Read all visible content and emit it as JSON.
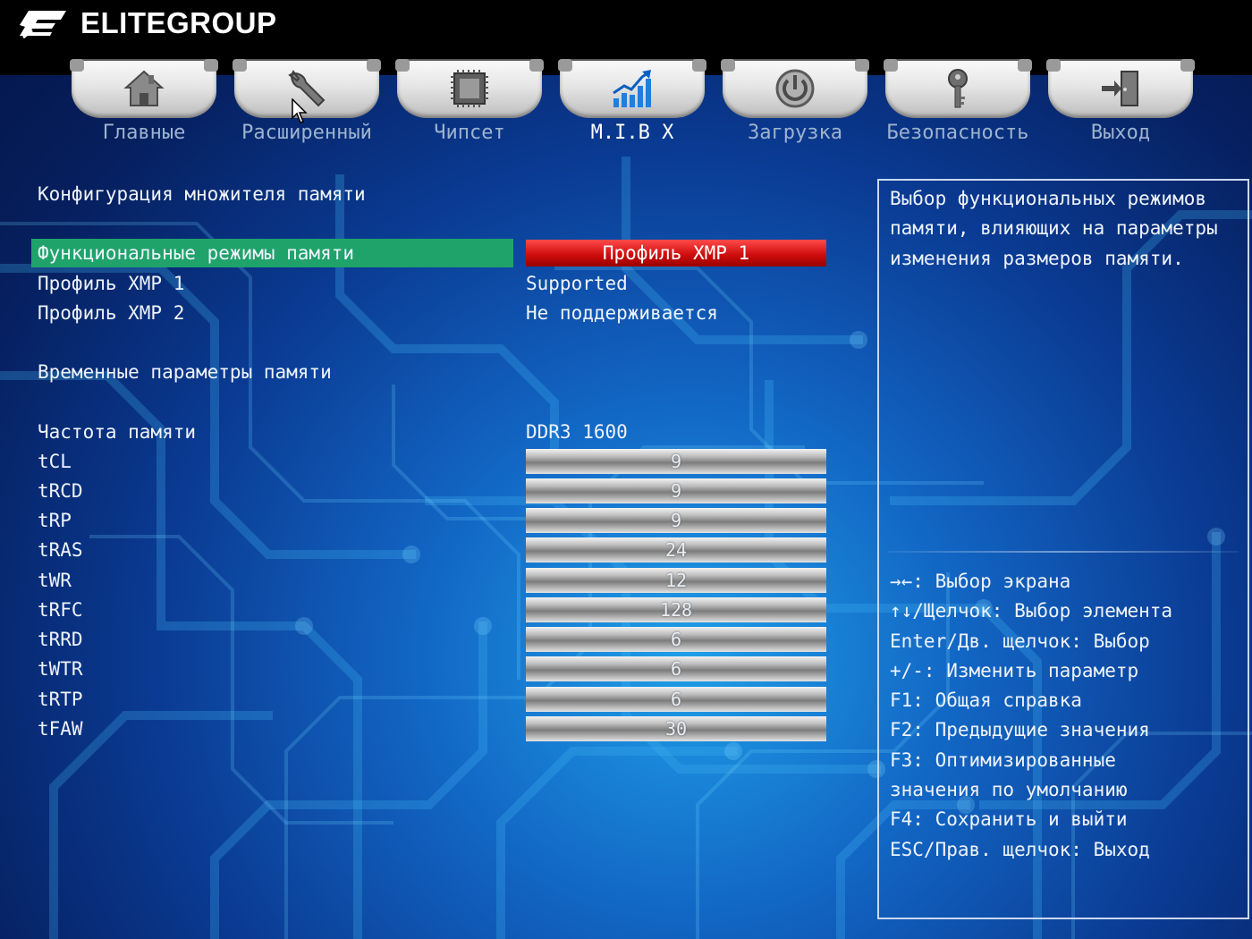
{
  "brand": {
    "logo_text": "ECS",
    "name": "ELITEGROUP"
  },
  "tabs": [
    {
      "label": "Главные",
      "icon": "home-icon"
    },
    {
      "label": "Расширенный",
      "icon": "wrench-icon"
    },
    {
      "label": "Чипсет",
      "icon": "chip-icon"
    },
    {
      "label": "M.I.B X",
      "icon": "performance-chart-icon",
      "active": true
    },
    {
      "label": "Загрузка",
      "icon": "power-icon"
    },
    {
      "label": "Безопасность",
      "icon": "key-icon"
    },
    {
      "label": "Выход",
      "icon": "exit-door-icon"
    }
  ],
  "main": {
    "section_title": "Конфигурация множителя памяти",
    "memory_mode": {
      "label": "Функциональные режимы памяти",
      "value": "Профиль XMP 1"
    },
    "xmp1": {
      "label": "Профиль XMP 1",
      "value": "Supported"
    },
    "xmp2": {
      "label": "Профиль XMP 2",
      "value": "Не поддерживается"
    },
    "timings_title": "Временные параметры памяти",
    "frequency": {
      "label": "Частота памяти",
      "value": "DDR3 1600"
    },
    "timings": [
      {
        "label": "tCL",
        "value": "9"
      },
      {
        "label": "tRCD",
        "value": "9"
      },
      {
        "label": "tRP",
        "value": "9"
      },
      {
        "label": "tRAS",
        "value": "24"
      },
      {
        "label": "tWR",
        "value": "12"
      },
      {
        "label": "tRFC",
        "value": "128"
      },
      {
        "label": "tRRD",
        "value": "6"
      },
      {
        "label": "tWTR",
        "value": "6"
      },
      {
        "label": "tRTP",
        "value": "6"
      },
      {
        "label": "tFAW",
        "value": "30"
      }
    ]
  },
  "help": {
    "description": "Выбор функциональных режимов памяти, влияющих на параметры изменения размеров памяти.",
    "keys": [
      "→←: Выбор экрана",
      "↑↓/Щелчок: Выбор элемента",
      "Enter/Дв. щелчок: Выбор",
      "+/-: Изменить параметр",
      "F1: Общая справка",
      "F2: Предыдущие значения",
      "F3: Оптимизированные",
      "значения по умолчанию",
      "F4: Сохранить и выйти",
      "ESC/Прав. щелчок: Выход"
    ]
  },
  "colors": {
    "selected_row": "#1fa36a",
    "selected_value": "#d10e0e",
    "background": "#0a3a92",
    "text": "#eef3fb",
    "inactive_tab_label": "#9db3cf"
  }
}
